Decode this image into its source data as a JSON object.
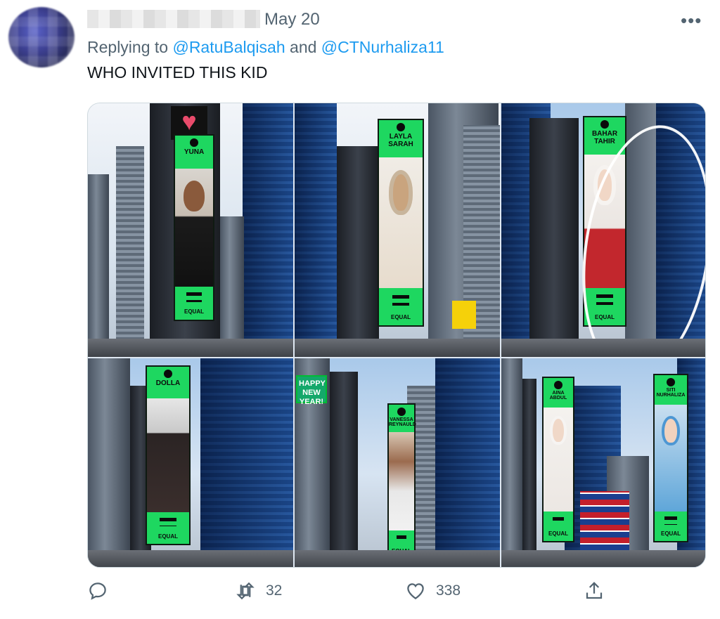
{
  "tweet": {
    "date": "May 20",
    "replying_prefix": "Replying to ",
    "mention_1": "@RatuBalqisah",
    "and_text": " and ",
    "mention_2": "@CTNurhaliza11",
    "text": "WHO INVITED THIS KID",
    "more_glyph": "•••"
  },
  "media": {
    "panels": [
      {
        "artist": "YUNA",
        "footer": "EQUAL"
      },
      {
        "artist": "LAYLA SARAH",
        "footer": "EQUAL"
      },
      {
        "artist": "BAHAR TAHIR",
        "footer": "EQUAL"
      },
      {
        "artist": "DOLLA",
        "footer": "EQUAL"
      },
      {
        "artist": "VANESSA REYNAULD",
        "footer": "EQUAL"
      },
      {
        "artist": "AINA ABDUL",
        "footer": "EQUAL"
      },
      {
        "artist": "SITI NURHALIZA",
        "footer": "EQUAL"
      }
    ],
    "happy_new_year": "HAPPY NEW YEAR!"
  },
  "actions": {
    "reply_count": "",
    "retweet_count": "32",
    "like_count": "338"
  },
  "icons": {
    "reply": "reply-icon",
    "retweet": "retweet-icon",
    "like": "heart-icon",
    "share": "share-icon",
    "more": "more-icon"
  },
  "colors": {
    "accent": "#1d9bf0",
    "muted": "#536471",
    "spotify_green": "#1ed760"
  }
}
